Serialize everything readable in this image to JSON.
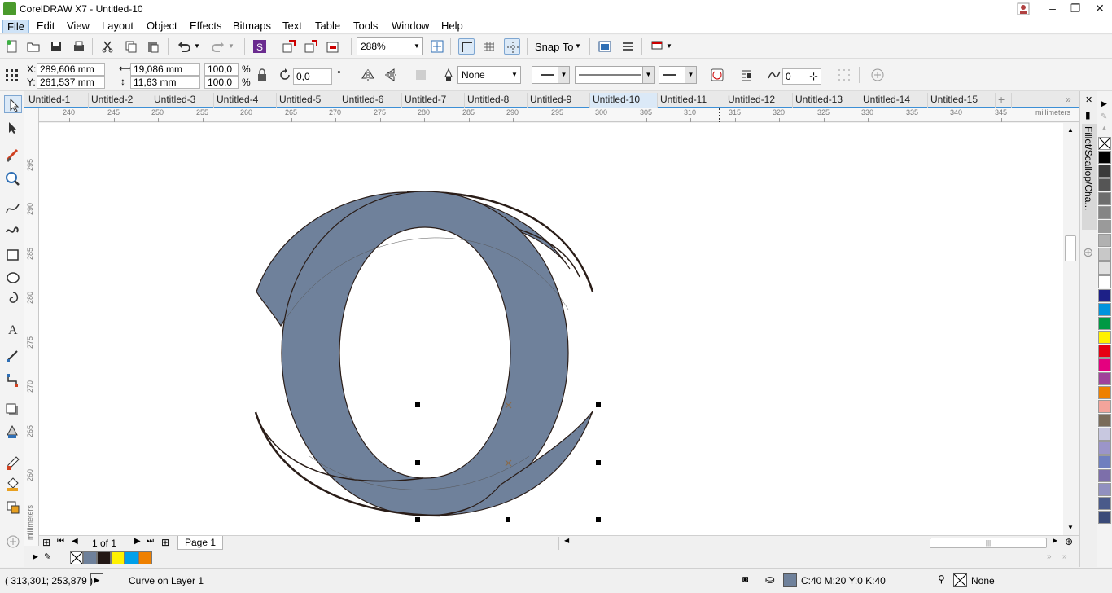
{
  "app": {
    "title": "CorelDRAW X7 - Untitled-10"
  },
  "menu": [
    "File",
    "Edit",
    "View",
    "Layout",
    "Object",
    "Effects",
    "Bitmaps",
    "Text",
    "Table",
    "Tools",
    "Window",
    "Help"
  ],
  "toolbar": {
    "zoom": "288%",
    "snap_label": "Snap To"
  },
  "propbar": {
    "x_label": "X:",
    "x": "289,606 mm",
    "y_label": "Y:",
    "y": "261,537 mm",
    "w": "19,086 mm",
    "h": "11,63 mm",
    "scale_w": "100,0",
    "scale_h": "100,0",
    "pct1": "%",
    "pct2": "%",
    "angle": "0,0",
    "deg": "°",
    "outline_width": "None",
    "smooth": "0"
  },
  "tabs": [
    "Untitled-1",
    "Untitled-2",
    "Untitled-3",
    "Untitled-4",
    "Untitled-5",
    "Untitled-6",
    "Untitled-7",
    "Untitled-8",
    "Untitled-9",
    "Untitled-10",
    "Untitled-11",
    "Untitled-12",
    "Untitled-13",
    "Untitled-14",
    "Untitled-15"
  ],
  "active_tab": "Untitled-10",
  "rulers": {
    "h_ticks": [
      "240",
      "245",
      "250",
      "255",
      "260",
      "265",
      "270",
      "275",
      "280",
      "285",
      "290",
      "295",
      "300",
      "305",
      "310",
      "315",
      "320",
      "325",
      "330",
      "335",
      "340",
      "345"
    ],
    "h_unit": "millimeters",
    "v_ticks": [
      "295",
      "290",
      "285",
      "280",
      "275",
      "270",
      "265",
      "260"
    ],
    "v_unit": "millimeters"
  },
  "pagenav": {
    "page_count": "1 of 1",
    "page_tab": "Page 1"
  },
  "docker": {
    "title": "Fillet/Scallop/Cha..."
  },
  "colors": {
    "fill": "#6f819b",
    "stroke": "#2a1d18",
    "doc_palette": [
      "#6f819b",
      "#231815",
      "#fff100",
      "#00a0e9",
      "#ee8000"
    ],
    "palette": [
      "#000000",
      "#3a3a3a",
      "#555555",
      "#6d6d6d",
      "#858585",
      "#9a9a9a",
      "#b1b1b1",
      "#c8c8c8",
      "#e0e0e0",
      "#ffffff",
      "#1d2087",
      "#0093dd",
      "#009944",
      "#fff100",
      "#e60012",
      "#e4007f",
      "#a0419a",
      "#ee8000",
      "#f3a49b",
      "#7a6c5b",
      "#c8c8e0",
      "#9b95c9",
      "#6f7fbf",
      "#7d6faa",
      "#9190c0",
      "#4a5a8a",
      "#3a4a78"
    ]
  },
  "status": {
    "coords": "( 313,301; 253,879 )",
    "object": "Curve on Layer 1",
    "fill_text": "C:40 M:20 Y:0 K:40",
    "outline_text": "None"
  }
}
